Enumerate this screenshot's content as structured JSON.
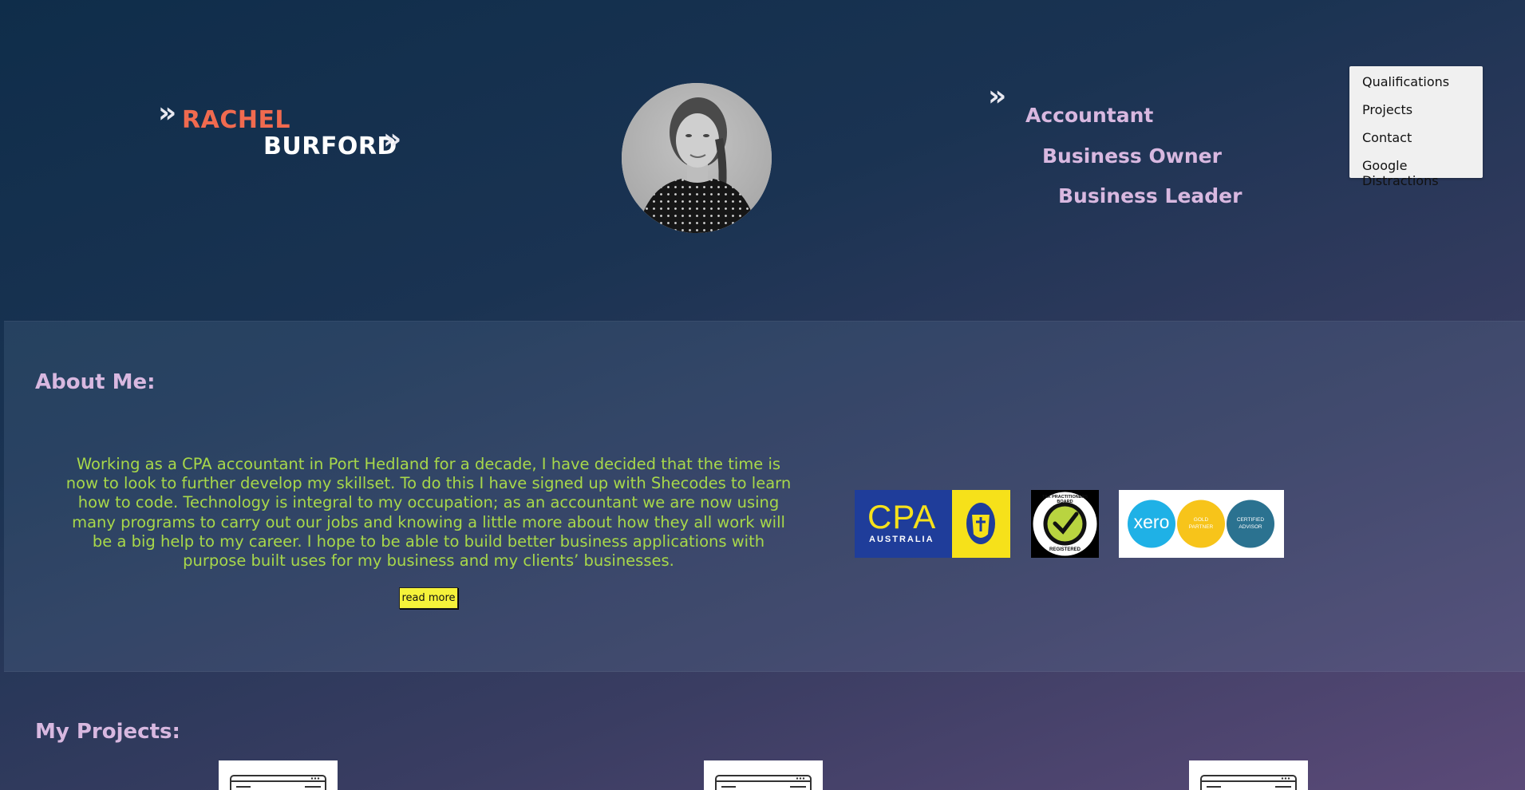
{
  "header": {
    "name_first": "RACHEL",
    "name_last": "BURFORD",
    "chevron_glyph": "»",
    "roles": [
      "Accountant",
      "Business Owner",
      "Business Leader"
    ]
  },
  "nav": {
    "items": [
      "Qualifications",
      "Projects",
      "Contact",
      "Google Distractions"
    ]
  },
  "about": {
    "heading": "About Me:",
    "text": "Working as a CPA accountant in Port Hedland for a decade, I have decided that the time is now to look to further develop my skillset. To do this I have signed up with Shecodes to learn how to code. Technology is integral to my occupation; as an accountant we are now using many programs to carry out our jobs and knowing a little more about how they all work will be a big help to my career. I hope to be able to build better business applications with purpose built uses for my business and my clients’ businesses.",
    "read_more": "read more"
  },
  "logos": {
    "cpa_main": "CPA",
    "cpa_sub": "AUSTRALIA",
    "tpb_top": "TAX PRACTITIONERS BOARD",
    "tpb_bottom": "REGISTERED",
    "xero": "xero",
    "xero_gold_1": "GOLD",
    "xero_gold_2": "PARTNER",
    "xero_cert_1": "CERTIFIED",
    "xero_cert_2": "ADVISOR"
  },
  "projects": {
    "heading": "My Projects:"
  },
  "colors": {
    "name_accent": "#f06a4f",
    "role_text": "#d8b8e0",
    "about_text": "#a8d84a",
    "button_bg": "#f5f23a"
  }
}
